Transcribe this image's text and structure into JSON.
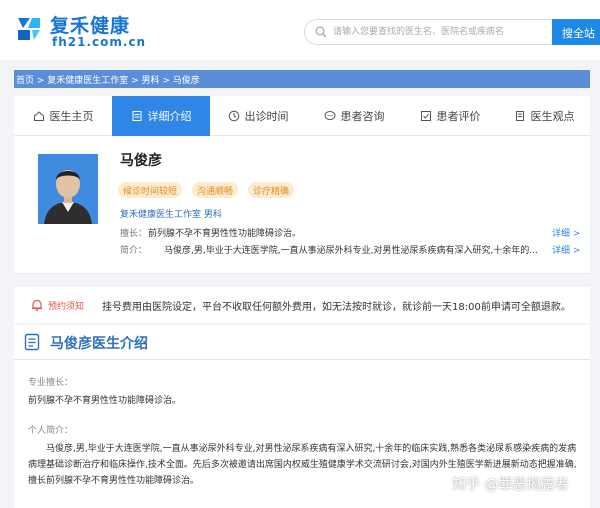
{
  "header": {
    "logo_main": "复禾健康",
    "logo_sub": "fh21.com.cn",
    "search_placeholder": "请输入您要查找的医生名、医院名或疾病名",
    "search_button": "搜全站"
  },
  "breadcrumb": {
    "text": "首页 > 复禾健康医生工作室 > 男科 > 马俊彦"
  },
  "tabs": [
    {
      "label": "医生主页"
    },
    {
      "label": "详细介绍"
    },
    {
      "label": "出诊时间"
    },
    {
      "label": "患者咨询"
    },
    {
      "label": "患者评价"
    },
    {
      "label": "医生观点"
    }
  ],
  "profile": {
    "name": "马俊彦",
    "tags": [
      "候诊时间较短",
      "沟通顺畅",
      "诊疗精确"
    ],
    "studio": "复禾健康医生工作室 男科",
    "specialty_label": "擅长：",
    "specialty": "前列腺不孕不育男性性功能障碍诊治。",
    "bio_label": "简介：",
    "bio": "马俊彦,男,毕业于大连医学院,一直从事泌尿外科专业,对男性泌尿系疾病有深入研究,十余年的...",
    "detail_link_1": "详细 >",
    "detail_link_2": "详细 >"
  },
  "notice": {
    "label": "预约须知",
    "text": "挂号费用由医院设定，平台不收取任何额外费用，如无法按时就诊，就诊前一天18:00前申请可全额退款。"
  },
  "intro": {
    "title": "马俊彦医生介绍",
    "specialty_label": "专业擅长：",
    "specialty_text": "前列腺不孕不育男性性功能障碍诊治。",
    "personal_label": "个人简介：",
    "personal_text": "马俊彦,男,毕业于大连医学院,一直从事泌尿外科专业,对男性泌尿系疾病有深入研究,十余年的临床实践,熟悉各类泌尿系感染疾病的发病病理基础诊断治疗和临床操作,技术全面。先后多次被邀请出席国内权威生殖健康学术交流研讨会,对国内外生殖医学新进展新动态把握准确,擅长前列腺不孕不育男性性功能障碍诊治。"
  },
  "watermark": "知乎 @罪恶揭露者",
  "colors": {
    "brand_blue": "#1976d2",
    "active_tab": "#2f86e6",
    "breadcrumb_bg": "#5b8ed8",
    "tag_bg": "#fbeccf",
    "tag_text": "#e58b1f",
    "notice_red": "#e2574c"
  }
}
